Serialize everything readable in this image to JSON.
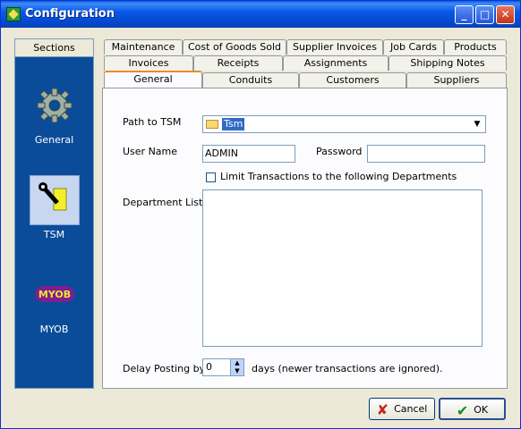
{
  "window": {
    "title": "Configuration"
  },
  "sections": {
    "header": "Sections",
    "items": [
      {
        "label": "General",
        "icon": "gear-icon"
      },
      {
        "label": "TSM",
        "icon": "key-icon"
      },
      {
        "label": "MYOB",
        "icon": "myob-logo"
      }
    ],
    "selected": "TSM"
  },
  "tabs": {
    "row1": [
      "Maintenance",
      "Cost of Goods Sold",
      "Supplier Invoices",
      "Job Cards",
      "Products"
    ],
    "row2": [
      "Invoices",
      "Receipts",
      "Assignments",
      "Shipping Notes"
    ],
    "row3": [
      "General",
      "Conduits",
      "Customers",
      "Suppliers"
    ],
    "active": "General"
  },
  "form": {
    "path_label": "Path to TSM",
    "path_value": "Tsm",
    "username_label": "User Name",
    "username_value": "ADMIN",
    "password_label": "Password",
    "password_value": "",
    "limit_label": "Limit Transactions to the following Departments",
    "limit_checked": false,
    "dept_label": "Department List",
    "delay_label": "Delay Posting by",
    "delay_value": "0",
    "delay_suffix": "days (newer transactions are ignored)."
  },
  "buttons": {
    "cancel": "Cancel",
    "ok": "OK"
  },
  "logo_text": "MYOB",
  "colors": {
    "sections_bg": "#0a4c9a",
    "accent_tab": "#e68b2c",
    "selection": "#316ac5"
  }
}
